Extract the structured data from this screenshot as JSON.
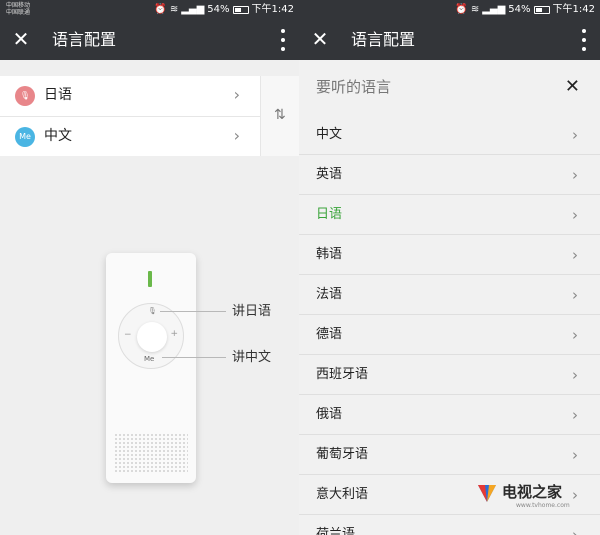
{
  "status_bar": {
    "left_screen": {
      "carrier_line1": "中国移动",
      "carrier_line2": "中国联通",
      "battery": "54%",
      "time": "下午1:42"
    },
    "right_screen": {
      "battery": "54%",
      "time": "下午1:42"
    },
    "icons": [
      "alarm-icon",
      "wifi-icon",
      "signal-icon",
      "battery-icon"
    ]
  },
  "left_screen": {
    "title": "语言配置",
    "source_language": {
      "label": "日语",
      "icon": "mic-icon"
    },
    "target_language": {
      "label": "中文",
      "badge": "Me"
    },
    "device": {
      "button_top": "🎙",
      "button_bottom": "Me",
      "minus": "−",
      "plus": "+",
      "callout_top": "讲日语",
      "callout_bottom": "讲中文"
    }
  },
  "right_screen": {
    "title": "语言配置",
    "sheet_title": "要听的语言",
    "selected": "日语",
    "items": [
      {
        "label": "中文",
        "selected": false
      },
      {
        "label": "英语",
        "selected": false
      },
      {
        "label": "日语",
        "selected": true
      },
      {
        "label": "韩语",
        "selected": false
      },
      {
        "label": "法语",
        "selected": false
      },
      {
        "label": "德语",
        "selected": false
      },
      {
        "label": "西班牙语",
        "selected": false
      },
      {
        "label": "俄语",
        "selected": false
      },
      {
        "label": "葡萄牙语",
        "selected": false
      },
      {
        "label": "意大利语",
        "selected": false
      },
      {
        "label": "荷兰语",
        "selected": false
      }
    ]
  },
  "watermark": {
    "text": "电视之家",
    "url": "www.tvhome.com"
  },
  "colors": {
    "titlebar": "#333539",
    "selected": "#3aa43a",
    "mic_badge": "#e8868a",
    "me_badge": "#4ab5e3",
    "led": "#6ab84a"
  }
}
